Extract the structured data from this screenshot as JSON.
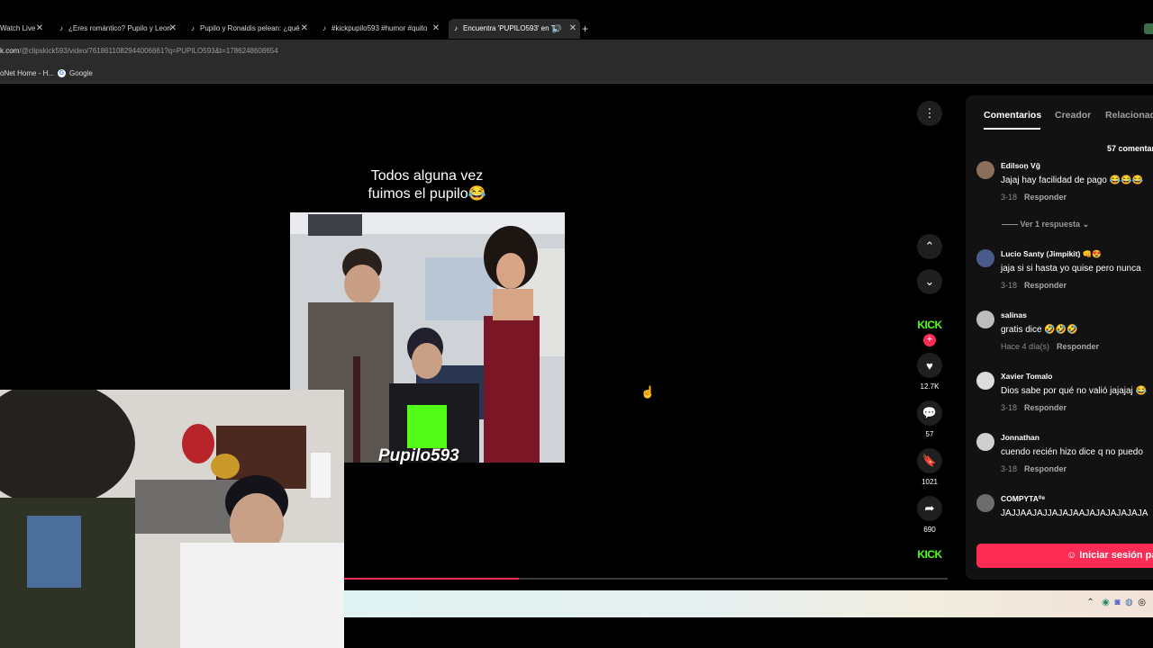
{
  "browser": {
    "tabs": [
      {
        "label": "Watch Live"
      },
      {
        "label": "¿Eres romántico? Pupilo y Leon"
      },
      {
        "label": "Pupilo y Ronaldis pelean: ¿qué"
      },
      {
        "label": "#kickpupilo593 #humor #quito"
      },
      {
        "label": "Encuentra 'PUPILO593' en T"
      }
    ],
    "new_tab": "+",
    "url_host": "k.com",
    "url_path": "/@clipskick593/video/7618611082944006661?q=PUPILO593&t=1786248608654",
    "bookmarks": [
      "oNet Home - H...",
      "Google"
    ]
  },
  "video": {
    "caption_line1": "Todos alguna vez",
    "caption_line2": "fuimos el pupilo😂",
    "watermark": "Pupilo593",
    "progress": 0.29
  },
  "actions": {
    "kick_label": "KICK",
    "likes": "12.7K",
    "comments": "57",
    "saves": "1021",
    "shares": "690"
  },
  "panel": {
    "tabs": [
      "Comentarios",
      "Creador",
      "Relacionad"
    ],
    "count": "57 comentar",
    "reply_label": "Responder",
    "view_replies": "Ver 1 respuesta",
    "login": "Iniciar sesión pa",
    "comments": [
      {
        "user": "Edilsoņ Vğ",
        "text": "Jajaj hay facilidad de pago 😂😂😂",
        "date": "3-18"
      },
      {
        "user": "Lucio Santy (Jimpikit) 👊😍",
        "text": "jaja si si hasta yo quise pero nunca",
        "date": "3-18"
      },
      {
        "user": "salinas",
        "text": "gratis dice 🤣🤣🤣",
        "date": "Hace 4 día(s)"
      },
      {
        "user": "Xavier Tomalo",
        "text": "Dios sabe por qué no valió jajajaj 😂",
        "date": "3-18"
      },
      {
        "user": "Jonnathan",
        "text": "cuendo recién hizo dice q no puedo",
        "date": "3-18"
      },
      {
        "user": "COMPYTA⁰⁸",
        "text": "JAJJAAJAJJAJAJAAJAJAJAJAJAJA",
        "date": ""
      }
    ]
  }
}
